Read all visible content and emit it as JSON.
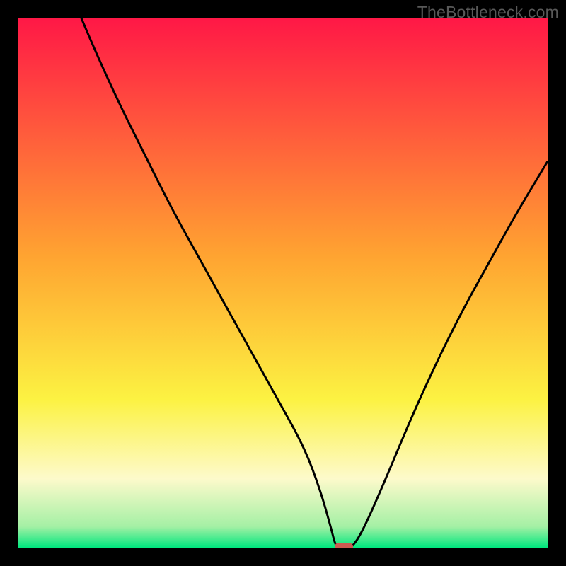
{
  "watermark": "TheBottleneck.com",
  "colors": {
    "black": "#000000",
    "curve": "#000000",
    "red": "#ff1846",
    "orange": "#ffa431",
    "yellow": "#fcf242",
    "cream": "#fdfacb",
    "green_light": "#a5f0a5",
    "green": "#00e77e",
    "marker": "#cc5a51"
  },
  "chart_data": {
    "type": "line",
    "title": "",
    "xlabel": "",
    "ylabel": "",
    "xlim": [
      0,
      100
    ],
    "ylim": [
      0,
      100
    ],
    "x": [
      0,
      4,
      9,
      14,
      19,
      24,
      29,
      34,
      39,
      44,
      49,
      54,
      57,
      59,
      60,
      61,
      62,
      63,
      65,
      69,
      74,
      79,
      84,
      89,
      94,
      100
    ],
    "values": [
      132,
      119,
      107,
      95,
      84,
      74,
      64,
      55,
      46,
      37,
      28,
      19,
      11,
      4,
      0,
      0,
      0,
      0,
      3,
      12,
      24,
      35,
      45,
      54,
      63,
      73
    ],
    "marker": {
      "x": 61.5,
      "y": 0
    },
    "gradient_stops": [
      {
        "pos": 0,
        "color": "#ff1846"
      },
      {
        "pos": 45,
        "color": "#ffa431"
      },
      {
        "pos": 72,
        "color": "#fcf242"
      },
      {
        "pos": 87,
        "color": "#fdfacb"
      },
      {
        "pos": 96,
        "color": "#a5f0a5"
      },
      {
        "pos": 100,
        "color": "#00e77e"
      }
    ]
  }
}
